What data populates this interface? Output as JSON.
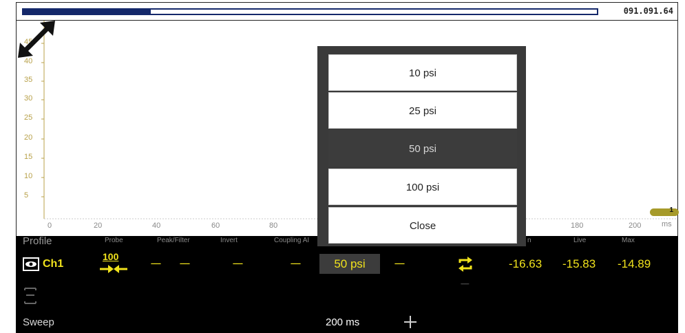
{
  "topbar": {
    "value": "091.091.64",
    "colors": {
      "scroll": "#14286a"
    }
  },
  "plot": {
    "y_ticks": [
      "45",
      "40",
      "35",
      "30",
      "25",
      "20",
      "15",
      "10",
      "5"
    ],
    "x_ticks": [
      "0",
      "20",
      "40",
      "60",
      "80",
      "180",
      "200"
    ],
    "x_unit": "ms",
    "marker_label": "1",
    "expand_icon": "expand-diagonal-arrows-icon"
  },
  "settings_header": {
    "profile": "Profile",
    "probe": "Probe",
    "peak_filter": "Peak/Filter",
    "invert": "Invert",
    "coupling": "Coupling AI",
    "min": "n",
    "live": "Live",
    "max": "Max"
  },
  "channel": {
    "label": "Ch1",
    "probe_value": "100",
    "dash": "------",
    "scale_value": "50 psi",
    "measurements": {
      "min": "-16.63",
      "live": "-15.83",
      "max": "-14.89"
    },
    "accent": "#f0e21c"
  },
  "row2": {
    "dash": "-------"
  },
  "sweep": {
    "label": "Sweep",
    "value": "200 ms"
  },
  "dropdown": {
    "options": [
      "10 psi",
      "25 psi",
      "50 psi",
      "100 psi"
    ],
    "selected": "50 psi",
    "close": "Close"
  }
}
